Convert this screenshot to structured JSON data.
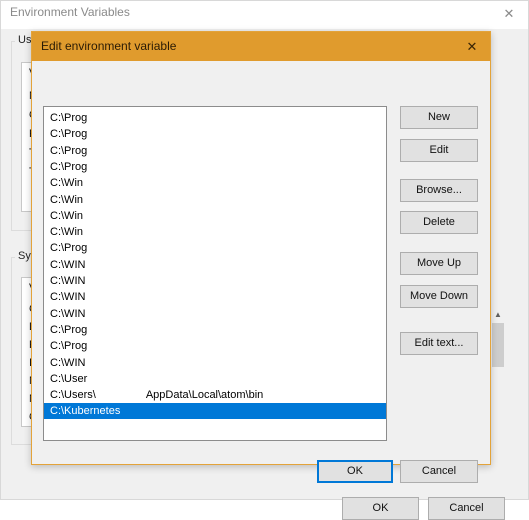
{
  "background_window": {
    "title": "Environment Variables",
    "close_icon": "close-icon",
    "user_section": {
      "label": "User",
      "column_header": "Va",
      "rows": [
        "M",
        "Or",
        "Pa",
        "TE",
        "TM"
      ]
    },
    "system_section": {
      "label": "Syste",
      "column_header": "Va",
      "rows": [
        "Co",
        "Dr",
        "FP",
        "IN",
        "M",
        "NU",
        "OS"
      ]
    },
    "scrollbar": {
      "up_arrow_icon": "chevron-up-icon"
    },
    "ok_label": "OK",
    "cancel_label": "Cancel"
  },
  "dialog": {
    "title": "Edit environment variable",
    "close_icon": "close-icon",
    "path_list": {
      "selected_index": 18,
      "items": [
        {
          "text": "C:\\Prog",
          "tail": ""
        },
        {
          "text": "C:\\Prog",
          "tail": ""
        },
        {
          "text": "C:\\Prog",
          "tail": ""
        },
        {
          "text": "C:\\Prog",
          "tail": ""
        },
        {
          "text": "C:\\Win",
          "tail": ""
        },
        {
          "text": "C:\\Win",
          "tail": ""
        },
        {
          "text": "C:\\Win",
          "tail": ""
        },
        {
          "text": "C:\\Win",
          "tail": ""
        },
        {
          "text": "C:\\Prog",
          "tail": ""
        },
        {
          "text": "C:\\WIN",
          "tail": ""
        },
        {
          "text": "C:\\WIN",
          "tail": ""
        },
        {
          "text": "C:\\WIN",
          "tail": ""
        },
        {
          "text": "C:\\WIN",
          "tail": ""
        },
        {
          "text": "C:\\Prog",
          "tail": ""
        },
        {
          "text": "C:\\Prog",
          "tail": ""
        },
        {
          "text": "C:\\WIN",
          "tail": ""
        },
        {
          "text": "C:\\User",
          "tail": ""
        },
        {
          "text": "C:\\Users\\",
          "tail": "AppData\\Local\\atom\\bin"
        },
        {
          "text": "C:\\Kubernetes",
          "tail": ""
        }
      ]
    },
    "buttons": {
      "new": "New",
      "edit": "Edit",
      "browse": "Browse...",
      "delete": "Delete",
      "move_up": "Move Up",
      "move_down": "Move Down",
      "edit_text": "Edit text...",
      "ok": "OK",
      "cancel": "Cancel"
    }
  },
  "colors": {
    "dialog_title_bar": "#e09b2d",
    "selection_blue": "#0078d7",
    "window_background": "#f0f0f0",
    "list_background": "#ffffff"
  }
}
